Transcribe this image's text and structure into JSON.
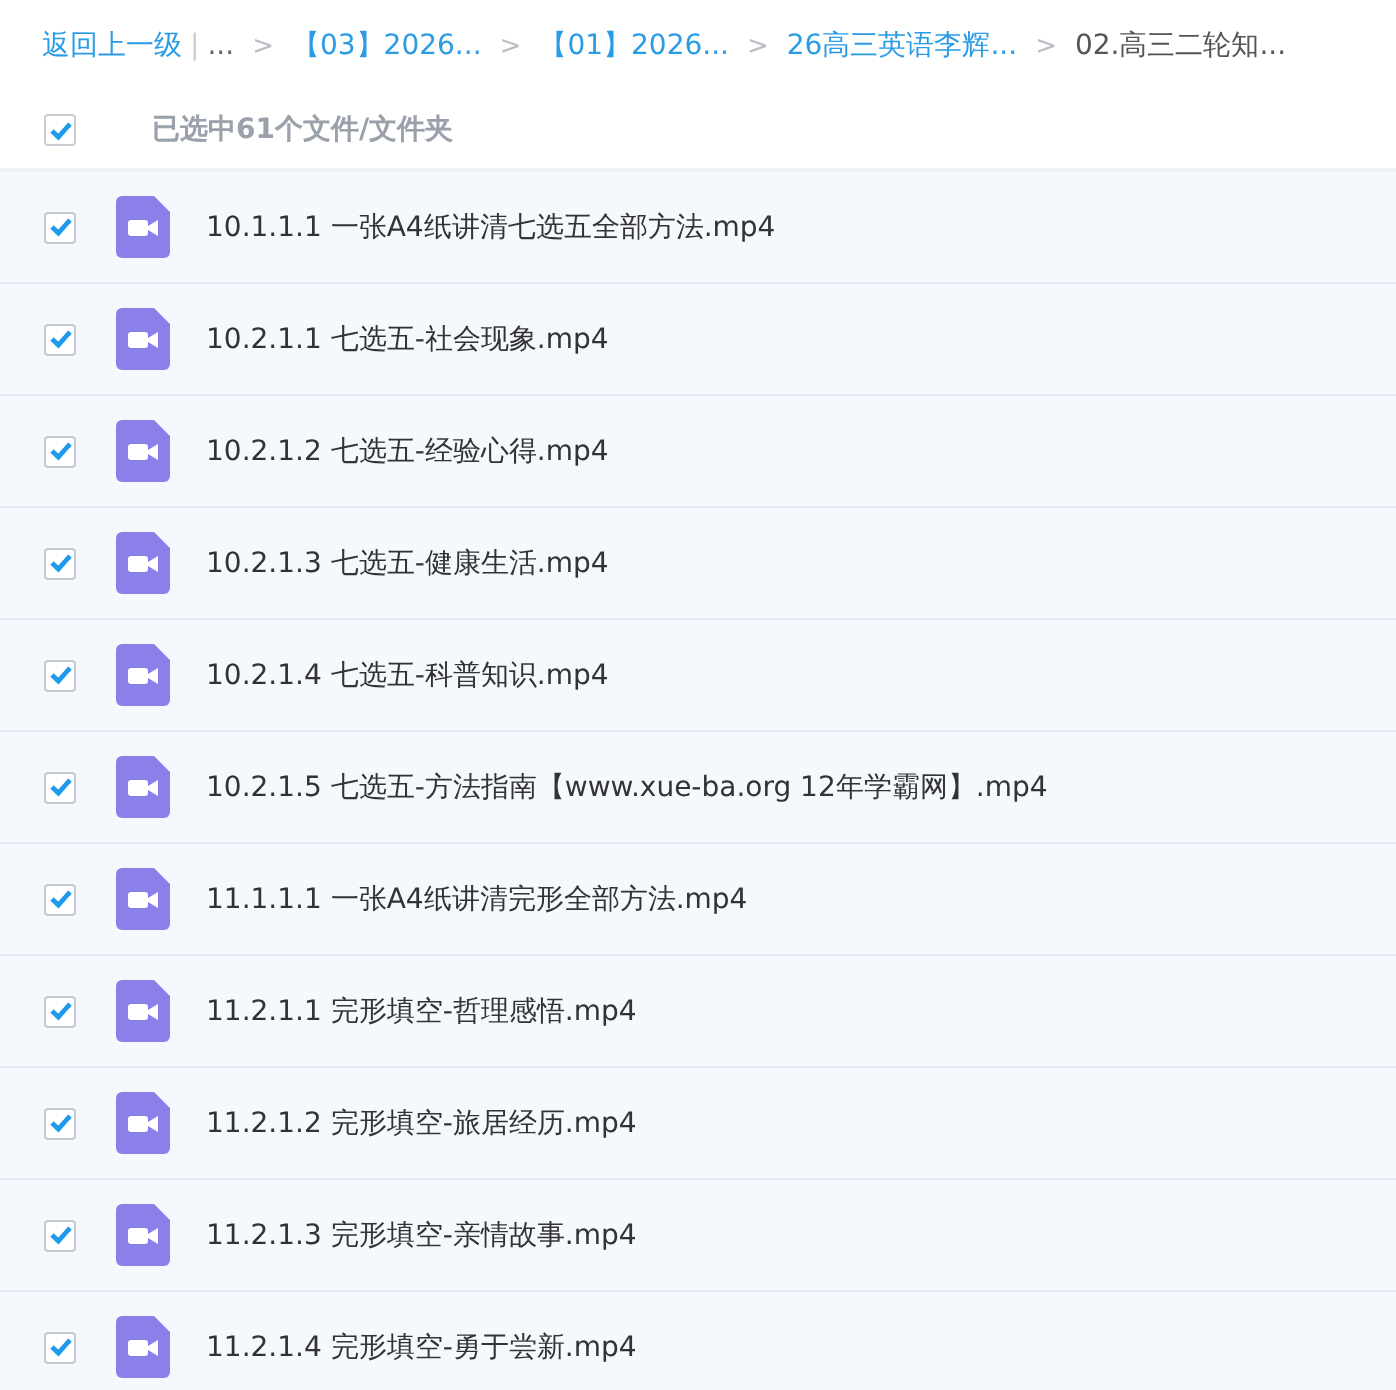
{
  "breadcrumb": {
    "back": "返回上一级",
    "separator": "|",
    "ellipsis": "...",
    "items": [
      {
        "label": "【03】2026...",
        "current": false
      },
      {
        "label": "【01】2026...",
        "current": false
      },
      {
        "label": "26高三英语李辉...",
        "current": false
      },
      {
        "label": "02.高三二轮知...",
        "current": true
      }
    ],
    "arrow": ">"
  },
  "select_all": {
    "checked": true,
    "label": "已选中61个文件/文件夹"
  },
  "files": [
    {
      "name": "10.1.1.1 一张A4纸讲清七选五全部方法.mp4",
      "checked": true
    },
    {
      "name": "10.2.1.1 七选五-社会现象.mp4",
      "checked": true
    },
    {
      "name": "10.2.1.2 七选五-经验心得.mp4",
      "checked": true
    },
    {
      "name": "10.2.1.3 七选五-健康生活.mp4",
      "checked": true
    },
    {
      "name": "10.2.1.4 七选五-科普知识.mp4",
      "checked": true
    },
    {
      "name": "10.2.1.5 七选五-方法指南【www.xue-ba.org 12年学霸网】.mp4",
      "checked": true
    },
    {
      "name": "11.1.1.1 一张A4纸讲清完形全部方法.mp4",
      "checked": true
    },
    {
      "name": "11.2.1.1 完形填空-哲理感悟.mp4",
      "checked": true
    },
    {
      "name": "11.2.1.2 完形填空-旅居经历.mp4",
      "checked": true
    },
    {
      "name": "11.2.1.3 完形填空-亲情故事.mp4",
      "checked": true
    },
    {
      "name": "11.2.1.4 完形填空-勇于尝新.mp4",
      "checked": true
    }
  ]
}
